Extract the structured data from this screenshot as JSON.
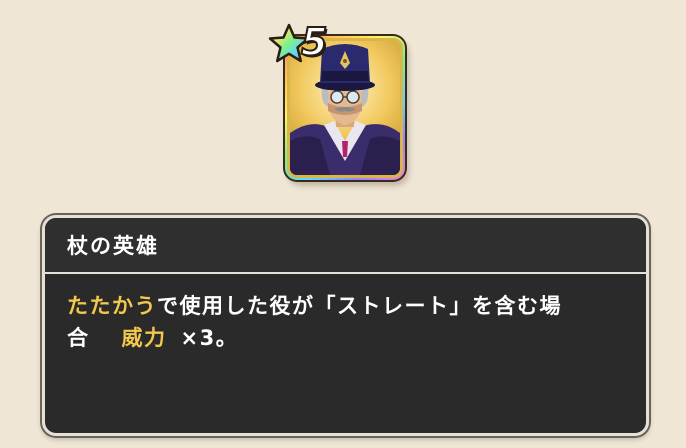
{
  "card": {
    "rank": "5",
    "frame_colors": [
      "#ff6e8a",
      "#ffc257",
      "#fff36a",
      "#7ef08a",
      "#5fd6ff",
      "#8f86ff",
      "#ff7ad7"
    ],
    "character_icon": "hero-portrait-icon"
  },
  "skill": {
    "title": "杖の英雄",
    "line1_highlight": "たたかう",
    "line1_text": "で使用した役が「ストレート」を含む場",
    "line2_text": "合",
    "line2_highlight": "威力",
    "line2_value": "×3。"
  },
  "colors": {
    "background": "#efe6d6",
    "dialog_bg": "#2a2a2a",
    "highlight": "#f2c94c",
    "text": "#ffffff"
  }
}
